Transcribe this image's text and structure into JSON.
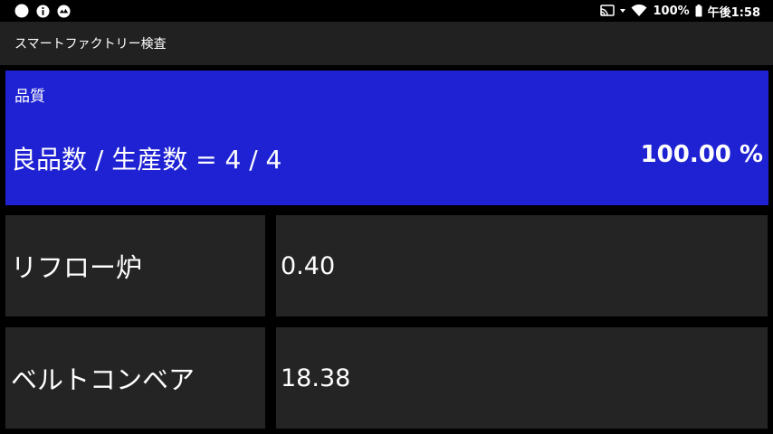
{
  "status_bar": {
    "left_icons": [
      "circle-icon",
      "info-icon",
      "app-badge-icon"
    ],
    "right_icons": [
      "cast-icon",
      "wifi-icon",
      "battery-icon"
    ],
    "battery_percent": "100%",
    "time": "午後1:58"
  },
  "app_bar": {
    "title": "スマートファクトリー検査"
  },
  "quality": {
    "label": "品質",
    "formula": "良品数 / 生産数 = 4 / 4",
    "percent": "100.00 %",
    "color": "#1f22d2"
  },
  "metrics": [
    {
      "name": "リフロー炉",
      "value": "0.40"
    },
    {
      "name": "ベルトコンベア",
      "value": "18.38"
    }
  ]
}
